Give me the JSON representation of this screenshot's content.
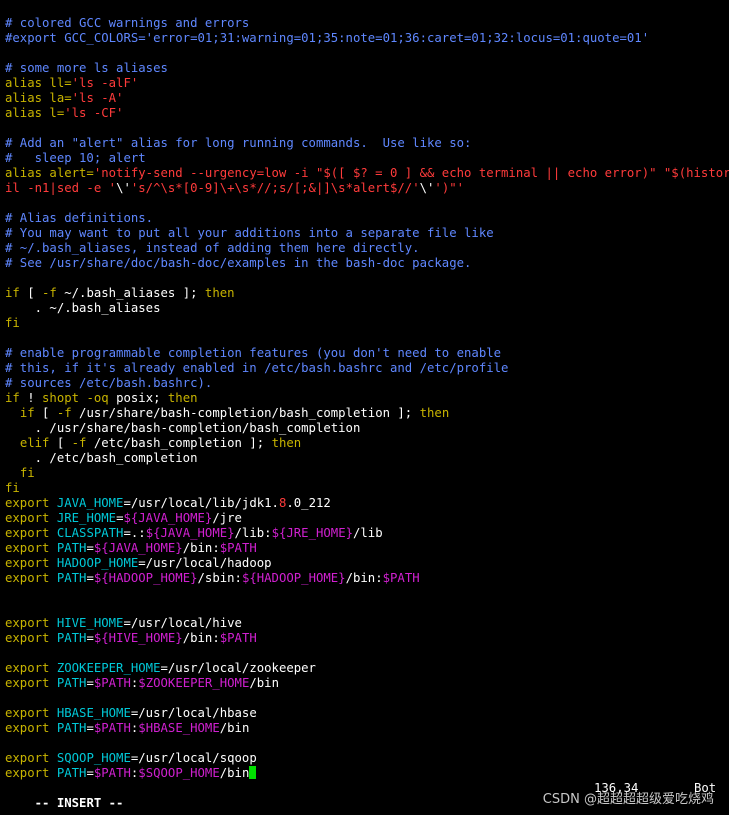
{
  "colors": {
    "background": "#000000",
    "default": "#ffffff",
    "comment": "#5f87ff",
    "string": "#ff3b3b",
    "keyword": "#c8b400",
    "identifier": "#00c8d7",
    "variable": "#d020d0",
    "cursor": "#00e000"
  },
  "editor": {
    "lines": [
      [
        {
          "t": "# colored GCC warnings and errors",
          "c": "comment"
        }
      ],
      [
        {
          "t": "#export GCC_COLORS='error=01;31:warning=01;35:note=01;36:caret=01;32:locus=01:quote=01'",
          "c": "comment"
        }
      ],
      [],
      [
        {
          "t": "# some more ls aliases",
          "c": "comment"
        }
      ],
      [
        {
          "t": "alias ll=",
          "c": "keyword"
        },
        {
          "t": "'ls -alF'",
          "c": "string"
        }
      ],
      [
        {
          "t": "alias la=",
          "c": "keyword"
        },
        {
          "t": "'ls -A'",
          "c": "string"
        }
      ],
      [
        {
          "t": "alias l=",
          "c": "keyword"
        },
        {
          "t": "'ls -CF'",
          "c": "string"
        }
      ],
      [],
      [
        {
          "t": "# Add an \"alert\" alias for long running commands.  Use like so:",
          "c": "comment"
        }
      ],
      [
        {
          "t": "#   sleep 10; alert",
          "c": "comment"
        }
      ],
      [
        {
          "t": "alias alert=",
          "c": "keyword"
        },
        {
          "t": "'notify-send --urgency=low -i \"$([ $? = 0 ] && echo terminal || echo error)\" \"$(history|ta",
          "c": "string"
        }
      ],
      [
        {
          "t": "il -n1|sed -e '",
          "c": "string"
        },
        {
          "t": "\\'",
          "c": "default"
        },
        {
          "t": "'s/^\\s*[0-9]\\+\\s*//;s/[;&|]\\s*alert$//'",
          "c": "string"
        },
        {
          "t": "\\'",
          "c": "default"
        },
        {
          "t": "')\"'",
          "c": "string"
        }
      ],
      [],
      [
        {
          "t": "# Alias definitions.",
          "c": "comment"
        }
      ],
      [
        {
          "t": "# You may want to put all your additions into a separate file like",
          "c": "comment"
        }
      ],
      [
        {
          "t": "# ~/.bash_aliases, instead of adding them here directly.",
          "c": "comment"
        }
      ],
      [
        {
          "t": "# See /usr/share/doc/bash-doc/examples in the bash-doc package.",
          "c": "comment"
        }
      ],
      [],
      [
        {
          "t": "if",
          "c": "keyword"
        },
        {
          "t": " [ ",
          "c": "default"
        },
        {
          "t": "-f",
          "c": "keyword"
        },
        {
          "t": " ~/.bash_aliases ]; ",
          "c": "default"
        },
        {
          "t": "then",
          "c": "keyword"
        }
      ],
      [
        {
          "t": "    . ~/.bash_aliases",
          "c": "default"
        }
      ],
      [
        {
          "t": "fi",
          "c": "keyword"
        }
      ],
      [],
      [
        {
          "t": "# enable programmable completion features (you don't need to enable",
          "c": "comment"
        }
      ],
      [
        {
          "t": "# this, if it's already enabled in /etc/bash.bashrc and /etc/profile",
          "c": "comment"
        }
      ],
      [
        {
          "t": "# sources /etc/bash.bashrc).",
          "c": "comment"
        }
      ],
      [
        {
          "t": "if",
          "c": "keyword"
        },
        {
          "t": " ! ",
          "c": "default"
        },
        {
          "t": "shopt -oq",
          "c": "keyword"
        },
        {
          "t": " posix; ",
          "c": "default"
        },
        {
          "t": "then",
          "c": "keyword"
        }
      ],
      [
        {
          "t": "  ",
          "c": "default"
        },
        {
          "t": "if",
          "c": "keyword"
        },
        {
          "t": " [ ",
          "c": "default"
        },
        {
          "t": "-f",
          "c": "keyword"
        },
        {
          "t": " /usr/share/bash-completion/bash_completion ]; ",
          "c": "default"
        },
        {
          "t": "then",
          "c": "keyword"
        }
      ],
      [
        {
          "t": "    . /usr/share/bash-completion/bash_completion",
          "c": "default"
        }
      ],
      [
        {
          "t": "  ",
          "c": "default"
        },
        {
          "t": "elif",
          "c": "keyword"
        },
        {
          "t": " [ ",
          "c": "default"
        },
        {
          "t": "-f",
          "c": "keyword"
        },
        {
          "t": " /etc/bash_completion ]; ",
          "c": "default"
        },
        {
          "t": "then",
          "c": "keyword"
        }
      ],
      [
        {
          "t": "    . /etc/bash_completion",
          "c": "default"
        }
      ],
      [
        {
          "t": "  ",
          "c": "default"
        },
        {
          "t": "fi",
          "c": "keyword"
        }
      ],
      [
        {
          "t": "fi",
          "c": "keyword"
        }
      ],
      [
        {
          "t": "export",
          "c": "keyword"
        },
        {
          "t": " ",
          "c": "default"
        },
        {
          "t": "JAVA_HOME",
          "c": "identifier"
        },
        {
          "t": "=/usr/local/lib/jdk1.",
          "c": "default"
        },
        {
          "t": "8",
          "c": "string"
        },
        {
          "t": ".0_212",
          "c": "default"
        }
      ],
      [
        {
          "t": "export",
          "c": "keyword"
        },
        {
          "t": " ",
          "c": "default"
        },
        {
          "t": "JRE_HOME",
          "c": "identifier"
        },
        {
          "t": "=",
          "c": "default"
        },
        {
          "t": "${JAVA_HOME}",
          "c": "variable"
        },
        {
          "t": "/jre",
          "c": "default"
        }
      ],
      [
        {
          "t": "export",
          "c": "keyword"
        },
        {
          "t": " ",
          "c": "default"
        },
        {
          "t": "CLASSPATH",
          "c": "identifier"
        },
        {
          "t": "=.:",
          "c": "default"
        },
        {
          "t": "${JAVA_HOME}",
          "c": "variable"
        },
        {
          "t": "/lib:",
          "c": "default"
        },
        {
          "t": "${JRE_HOME}",
          "c": "variable"
        },
        {
          "t": "/lib",
          "c": "default"
        }
      ],
      [
        {
          "t": "export",
          "c": "keyword"
        },
        {
          "t": " ",
          "c": "default"
        },
        {
          "t": "PATH",
          "c": "identifier"
        },
        {
          "t": "=",
          "c": "default"
        },
        {
          "t": "${JAVA_HOME}",
          "c": "variable"
        },
        {
          "t": "/bin:",
          "c": "default"
        },
        {
          "t": "$PATH",
          "c": "variable"
        }
      ],
      [
        {
          "t": "export",
          "c": "keyword"
        },
        {
          "t": " ",
          "c": "default"
        },
        {
          "t": "HADOOP_HOME",
          "c": "identifier"
        },
        {
          "t": "=/usr/local/hadoop",
          "c": "default"
        }
      ],
      [
        {
          "t": "export",
          "c": "keyword"
        },
        {
          "t": " ",
          "c": "default"
        },
        {
          "t": "PATH",
          "c": "identifier"
        },
        {
          "t": "=",
          "c": "default"
        },
        {
          "t": "${HADOOP_HOME}",
          "c": "variable"
        },
        {
          "t": "/sbin:",
          "c": "default"
        },
        {
          "t": "${HADOOP_HOME}",
          "c": "variable"
        },
        {
          "t": "/bin:",
          "c": "default"
        },
        {
          "t": "$PATH",
          "c": "variable"
        }
      ],
      [],
      [],
      [
        {
          "t": "export",
          "c": "keyword"
        },
        {
          "t": " ",
          "c": "default"
        },
        {
          "t": "HIVE_HOME",
          "c": "identifier"
        },
        {
          "t": "=/usr/local/hive",
          "c": "default"
        }
      ],
      [
        {
          "t": "export",
          "c": "keyword"
        },
        {
          "t": " ",
          "c": "default"
        },
        {
          "t": "PATH",
          "c": "identifier"
        },
        {
          "t": "=",
          "c": "default"
        },
        {
          "t": "${HIVE_HOME}",
          "c": "variable"
        },
        {
          "t": "/bin:",
          "c": "default"
        },
        {
          "t": "$PATH",
          "c": "variable"
        }
      ],
      [],
      [
        {
          "t": "export",
          "c": "keyword"
        },
        {
          "t": " ",
          "c": "default"
        },
        {
          "t": "ZOOKEEPER_HOME",
          "c": "identifier"
        },
        {
          "t": "=/usr/local/zookeeper",
          "c": "default"
        }
      ],
      [
        {
          "t": "export",
          "c": "keyword"
        },
        {
          "t": " ",
          "c": "default"
        },
        {
          "t": "PATH",
          "c": "identifier"
        },
        {
          "t": "=",
          "c": "default"
        },
        {
          "t": "$PATH",
          "c": "variable"
        },
        {
          "t": ":",
          "c": "default"
        },
        {
          "t": "$ZOOKEEPER_HOME",
          "c": "variable"
        },
        {
          "t": "/bin",
          "c": "default"
        }
      ],
      [],
      [
        {
          "t": "export",
          "c": "keyword"
        },
        {
          "t": " ",
          "c": "default"
        },
        {
          "t": "HBASE_HOME",
          "c": "identifier"
        },
        {
          "t": "=/usr/local/hbase",
          "c": "default"
        }
      ],
      [
        {
          "t": "export",
          "c": "keyword"
        },
        {
          "t": " ",
          "c": "default"
        },
        {
          "t": "PATH",
          "c": "identifier"
        },
        {
          "t": "=",
          "c": "default"
        },
        {
          "t": "$PATH",
          "c": "variable"
        },
        {
          "t": ":",
          "c": "default"
        },
        {
          "t": "$HBASE_HOME",
          "c": "variable"
        },
        {
          "t": "/bin",
          "c": "default"
        }
      ],
      [],
      [
        {
          "t": "export",
          "c": "keyword"
        },
        {
          "t": " ",
          "c": "default"
        },
        {
          "t": "SQOOP_HOME",
          "c": "identifier"
        },
        {
          "t": "=/usr/local/sqoop",
          "c": "default"
        }
      ],
      [
        {
          "t": "export",
          "c": "keyword"
        },
        {
          "t": " ",
          "c": "default"
        },
        {
          "t": "PATH",
          "c": "identifier"
        },
        {
          "t": "=",
          "c": "default"
        },
        {
          "t": "$PATH",
          "c": "variable"
        },
        {
          "t": ":",
          "c": "default"
        },
        {
          "t": "$SQOOP_HOME",
          "c": "variable"
        },
        {
          "t": "/bin",
          "c": "default"
        },
        {
          "cursor": true
        }
      ]
    ]
  },
  "statusline": {
    "mode": "-- INSERT --",
    "position": "136,34",
    "scroll": "Bot"
  },
  "watermark": {
    "text": "CSDN @超超超超级爱吃烧鸡"
  }
}
